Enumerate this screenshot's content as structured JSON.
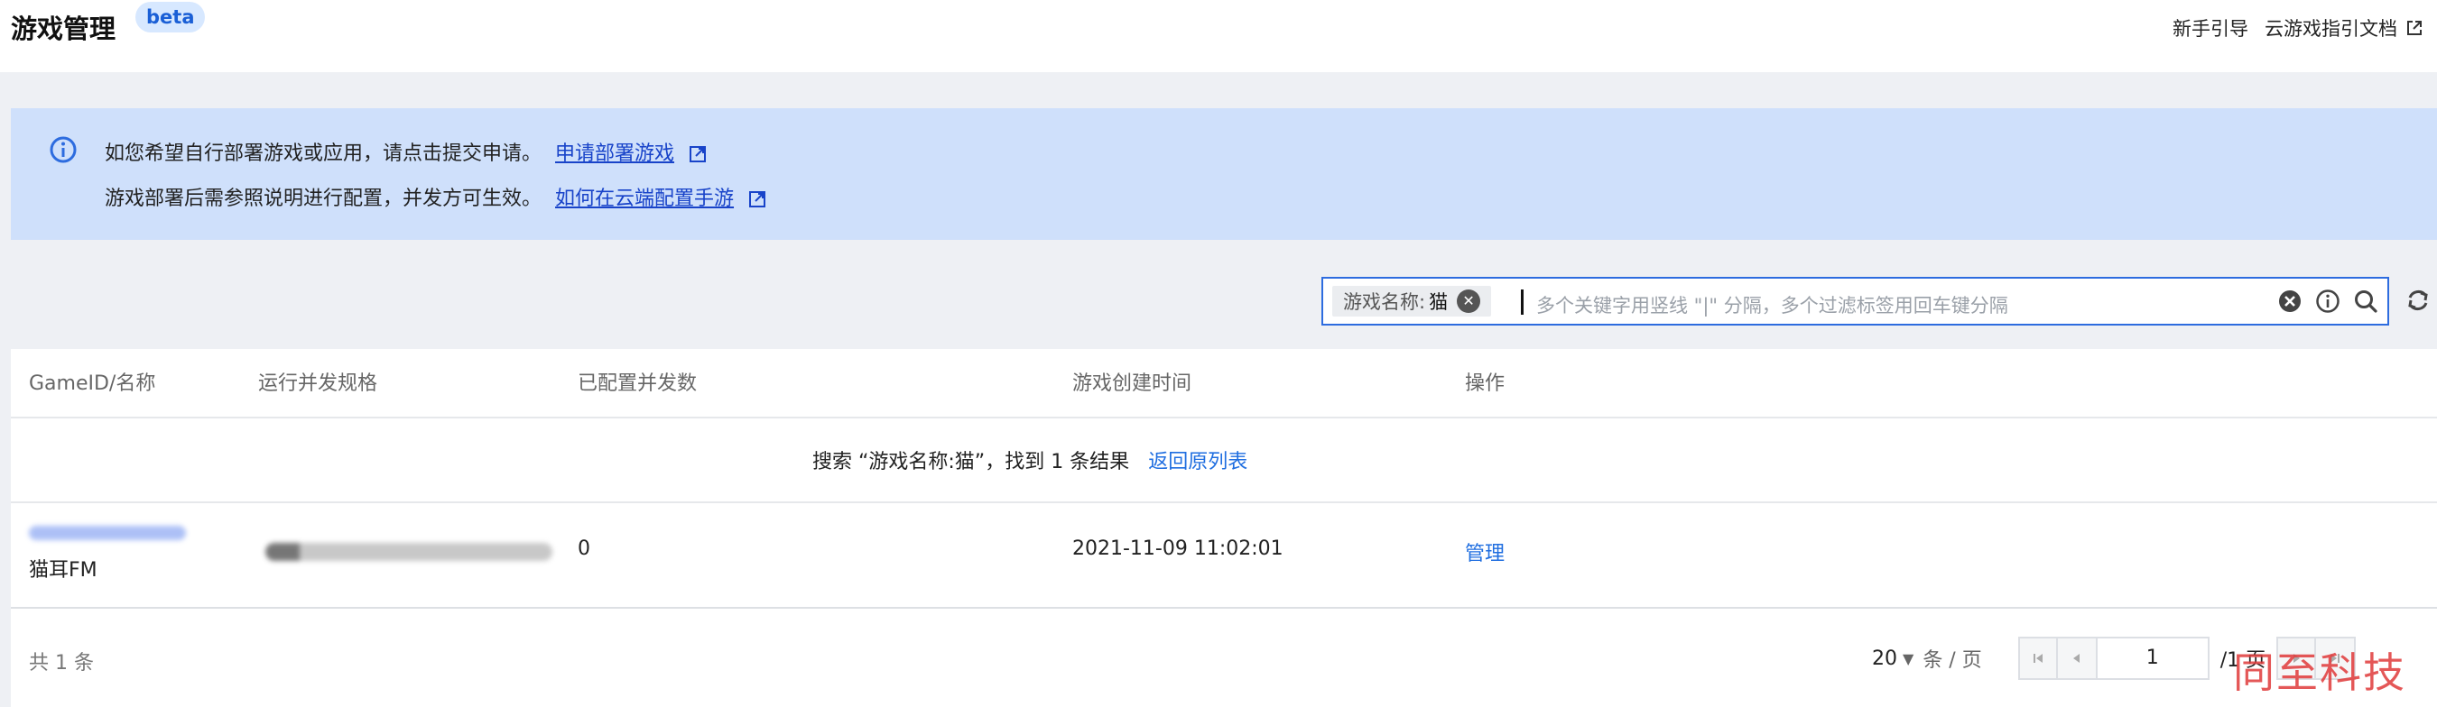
{
  "header": {
    "title": "游戏管理",
    "badge": "beta",
    "links": [
      "新手引导",
      "云游戏指引文档"
    ]
  },
  "notice": {
    "line1_text": "如您希望自行部署游戏或应用，请点击提交申请。",
    "line1_link": "申请部署游戏",
    "line2_text": "游戏部署后需参照说明进行配置，并发方可生效。",
    "line2_link": "如何在云端配置手游"
  },
  "search": {
    "tag_label": "游戏名称:",
    "tag_value": "猫",
    "placeholder": "多个关键字用竖线 \"|\" 分隔，多个过滤标签用回车键分隔"
  },
  "table": {
    "columns": [
      "GameID/名称",
      "运行并发规格",
      "已配置并发数",
      "游戏创建时间",
      "操作"
    ],
    "search_result_text": "搜索 “游戏名称:猫”，找到 1 条结果",
    "search_result_link": "返回原列表",
    "rows": [
      {
        "name": "猫耳FM",
        "concurrency": "0",
        "created": "2021-11-09 11:02:01",
        "action": "管理"
      }
    ]
  },
  "footer": {
    "total": "共 1 条",
    "page_size": "20",
    "page_size_unit": "条 / 页",
    "page_number": "1",
    "page_total": "/1 页"
  },
  "watermark": "同至科技",
  "colors": {
    "accent": "#1f6ee0",
    "notice_bg": "#cfe0fb",
    "watermark": "#e03a3a"
  }
}
